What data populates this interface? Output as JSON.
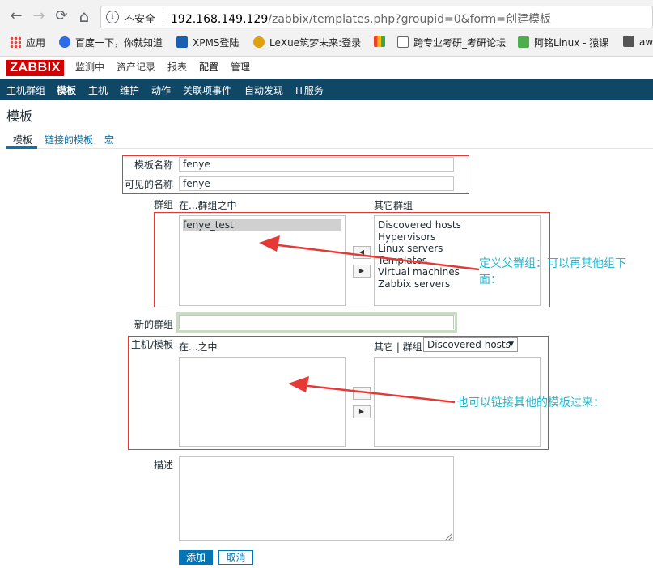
{
  "browser": {
    "back_icon": "←",
    "forward_icon": "→",
    "reload_icon": "⟳",
    "home_icon": "⌂",
    "info_icon": "i",
    "insecure_label": "不安全",
    "url_host": "192.168.149.129",
    "url_path": "/zabbix/templates.php?groupid=0&form=创建模板",
    "bookmarks": [
      {
        "label": "应用",
        "icon": "apps-grid-icon"
      },
      {
        "label": "百度一下，你就知道",
        "icon": "baidu-icon"
      },
      {
        "label": "XPMS登陆",
        "icon": "xp-icon"
      },
      {
        "label": "LeXue筑梦未来:登录",
        "icon": "lexue-icon"
      },
      {
        "label": "",
        "icon": "colorful-g-icon"
      },
      {
        "label": "跨专业考研_考研论坛",
        "icon": "page-icon"
      },
      {
        "label": "阿铭Linux - 猿课",
        "icon": "apelearn-icon"
      },
      {
        "label": "aw",
        "icon": "aw-icon"
      }
    ]
  },
  "zabbix": {
    "logo": "ZABBIX",
    "top_menu": [
      "监测中",
      "资产记录",
      "报表",
      "配置",
      "管理"
    ],
    "sub_menu": [
      "主机群组",
      "模板",
      "主机",
      "维护",
      "动作",
      "关联项事件",
      "自动发现",
      "IT服务"
    ],
    "active_sub": "模板",
    "page_title": "模板",
    "tabs": [
      "模板",
      "链接的模板",
      "宏"
    ]
  },
  "form": {
    "template_name_label": "模板名称",
    "template_name_value": "fenye",
    "visible_name_label": "可见的名称",
    "visible_name_value": "fenye",
    "groups_label": "群组",
    "in_groups_label": "在...群组之中",
    "other_groups_label": "其它群组",
    "in_groups": [
      "fenye_test"
    ],
    "other_groups": [
      "Discovered hosts",
      "Hypervisors",
      "Linux servers",
      "Templates",
      "Virtual machines",
      "Zabbix servers"
    ],
    "new_group_label": "新的群组",
    "new_group_value": "",
    "hosts_templates_label": "主机/模板",
    "in_label": "在...之中",
    "other_group_label": "其它 | 群组",
    "group_select_value": "Discovered hosts",
    "description_label": "描述",
    "description_value": "",
    "add_button": "添加",
    "cancel_button": "取消",
    "move_left_icon": "◀",
    "move_right_icon": "▶",
    "select_caret": "▼"
  },
  "annotations": {
    "note1_line1": "定义父群组：可以再其他组下",
    "note1_line2": "面：",
    "note2": "也可以链接其他的模板过来：",
    "arrow_color": "#e53935",
    "text_color": "#22b8cf"
  }
}
